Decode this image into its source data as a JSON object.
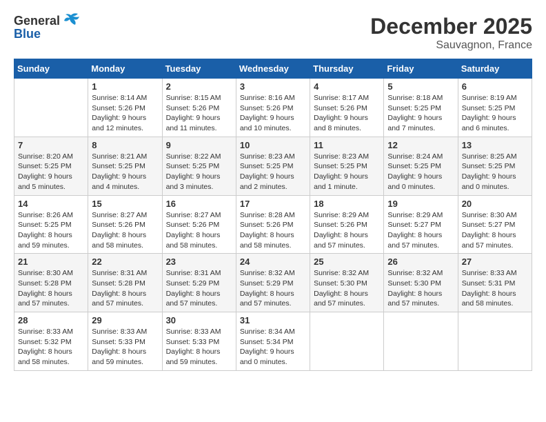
{
  "header": {
    "logo_general": "General",
    "logo_blue": "Blue",
    "month_title": "December 2025",
    "location": "Sauvagnon, France"
  },
  "days_of_week": [
    "Sunday",
    "Monday",
    "Tuesday",
    "Wednesday",
    "Thursday",
    "Friday",
    "Saturday"
  ],
  "weeks": [
    [
      {
        "day": "",
        "sunrise": "",
        "sunset": "",
        "daylight": ""
      },
      {
        "day": "1",
        "sunrise": "Sunrise: 8:14 AM",
        "sunset": "Sunset: 5:26 PM",
        "daylight": "Daylight: 9 hours and 12 minutes."
      },
      {
        "day": "2",
        "sunrise": "Sunrise: 8:15 AM",
        "sunset": "Sunset: 5:26 PM",
        "daylight": "Daylight: 9 hours and 11 minutes."
      },
      {
        "day": "3",
        "sunrise": "Sunrise: 8:16 AM",
        "sunset": "Sunset: 5:26 PM",
        "daylight": "Daylight: 9 hours and 10 minutes."
      },
      {
        "day": "4",
        "sunrise": "Sunrise: 8:17 AM",
        "sunset": "Sunset: 5:26 PM",
        "daylight": "Daylight: 9 hours and 8 minutes."
      },
      {
        "day": "5",
        "sunrise": "Sunrise: 8:18 AM",
        "sunset": "Sunset: 5:25 PM",
        "daylight": "Daylight: 9 hours and 7 minutes."
      },
      {
        "day": "6",
        "sunrise": "Sunrise: 8:19 AM",
        "sunset": "Sunset: 5:25 PM",
        "daylight": "Daylight: 9 hours and 6 minutes."
      }
    ],
    [
      {
        "day": "7",
        "sunrise": "Sunrise: 8:20 AM",
        "sunset": "Sunset: 5:25 PM",
        "daylight": "Daylight: 9 hours and 5 minutes."
      },
      {
        "day": "8",
        "sunrise": "Sunrise: 8:21 AM",
        "sunset": "Sunset: 5:25 PM",
        "daylight": "Daylight: 9 hours and 4 minutes."
      },
      {
        "day": "9",
        "sunrise": "Sunrise: 8:22 AM",
        "sunset": "Sunset: 5:25 PM",
        "daylight": "Daylight: 9 hours and 3 minutes."
      },
      {
        "day": "10",
        "sunrise": "Sunrise: 8:23 AM",
        "sunset": "Sunset: 5:25 PM",
        "daylight": "Daylight: 9 hours and 2 minutes."
      },
      {
        "day": "11",
        "sunrise": "Sunrise: 8:23 AM",
        "sunset": "Sunset: 5:25 PM",
        "daylight": "Daylight: 9 hours and 1 minute."
      },
      {
        "day": "12",
        "sunrise": "Sunrise: 8:24 AM",
        "sunset": "Sunset: 5:25 PM",
        "daylight": "Daylight: 9 hours and 0 minutes."
      },
      {
        "day": "13",
        "sunrise": "Sunrise: 8:25 AM",
        "sunset": "Sunset: 5:25 PM",
        "daylight": "Daylight: 9 hours and 0 minutes."
      }
    ],
    [
      {
        "day": "14",
        "sunrise": "Sunrise: 8:26 AM",
        "sunset": "Sunset: 5:25 PM",
        "daylight": "Daylight: 8 hours and 59 minutes."
      },
      {
        "day": "15",
        "sunrise": "Sunrise: 8:27 AM",
        "sunset": "Sunset: 5:26 PM",
        "daylight": "Daylight: 8 hours and 58 minutes."
      },
      {
        "day": "16",
        "sunrise": "Sunrise: 8:27 AM",
        "sunset": "Sunset: 5:26 PM",
        "daylight": "Daylight: 8 hours and 58 minutes."
      },
      {
        "day": "17",
        "sunrise": "Sunrise: 8:28 AM",
        "sunset": "Sunset: 5:26 PM",
        "daylight": "Daylight: 8 hours and 58 minutes."
      },
      {
        "day": "18",
        "sunrise": "Sunrise: 8:29 AM",
        "sunset": "Sunset: 5:26 PM",
        "daylight": "Daylight: 8 hours and 57 minutes."
      },
      {
        "day": "19",
        "sunrise": "Sunrise: 8:29 AM",
        "sunset": "Sunset: 5:27 PM",
        "daylight": "Daylight: 8 hours and 57 minutes."
      },
      {
        "day": "20",
        "sunrise": "Sunrise: 8:30 AM",
        "sunset": "Sunset: 5:27 PM",
        "daylight": "Daylight: 8 hours and 57 minutes."
      }
    ],
    [
      {
        "day": "21",
        "sunrise": "Sunrise: 8:30 AM",
        "sunset": "Sunset: 5:28 PM",
        "daylight": "Daylight: 8 hours and 57 minutes."
      },
      {
        "day": "22",
        "sunrise": "Sunrise: 8:31 AM",
        "sunset": "Sunset: 5:28 PM",
        "daylight": "Daylight: 8 hours and 57 minutes."
      },
      {
        "day": "23",
        "sunrise": "Sunrise: 8:31 AM",
        "sunset": "Sunset: 5:29 PM",
        "daylight": "Daylight: 8 hours and 57 minutes."
      },
      {
        "day": "24",
        "sunrise": "Sunrise: 8:32 AM",
        "sunset": "Sunset: 5:29 PM",
        "daylight": "Daylight: 8 hours and 57 minutes."
      },
      {
        "day": "25",
        "sunrise": "Sunrise: 8:32 AM",
        "sunset": "Sunset: 5:30 PM",
        "daylight": "Daylight: 8 hours and 57 minutes."
      },
      {
        "day": "26",
        "sunrise": "Sunrise: 8:32 AM",
        "sunset": "Sunset: 5:30 PM",
        "daylight": "Daylight: 8 hours and 57 minutes."
      },
      {
        "day": "27",
        "sunrise": "Sunrise: 8:33 AM",
        "sunset": "Sunset: 5:31 PM",
        "daylight": "Daylight: 8 hours and 58 minutes."
      }
    ],
    [
      {
        "day": "28",
        "sunrise": "Sunrise: 8:33 AM",
        "sunset": "Sunset: 5:32 PM",
        "daylight": "Daylight: 8 hours and 58 minutes."
      },
      {
        "day": "29",
        "sunrise": "Sunrise: 8:33 AM",
        "sunset": "Sunset: 5:33 PM",
        "daylight": "Daylight: 8 hours and 59 minutes."
      },
      {
        "day": "30",
        "sunrise": "Sunrise: 8:33 AM",
        "sunset": "Sunset: 5:33 PM",
        "daylight": "Daylight: 8 hours and 59 minutes."
      },
      {
        "day": "31",
        "sunrise": "Sunrise: 8:34 AM",
        "sunset": "Sunset: 5:34 PM",
        "daylight": "Daylight: 9 hours and 0 minutes."
      },
      {
        "day": "",
        "sunrise": "",
        "sunset": "",
        "daylight": ""
      },
      {
        "day": "",
        "sunrise": "",
        "sunset": "",
        "daylight": ""
      },
      {
        "day": "",
        "sunrise": "",
        "sunset": "",
        "daylight": ""
      }
    ]
  ]
}
